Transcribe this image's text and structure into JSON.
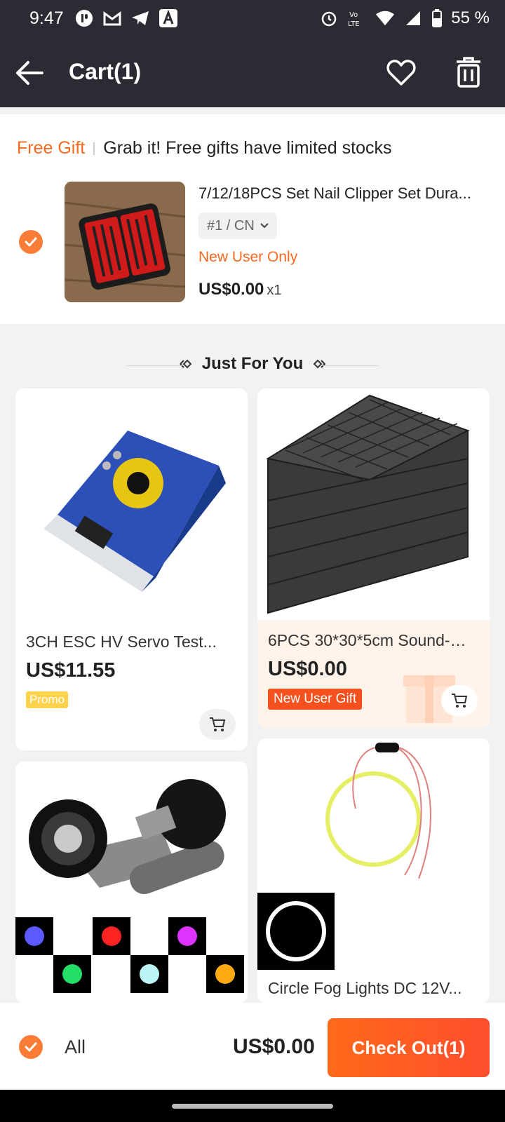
{
  "status_bar": {
    "time": "9:47",
    "battery": "55 %"
  },
  "header": {
    "title": "Cart(1)"
  },
  "gift_section": {
    "tag": "Free Gift",
    "note": "Grab it! Free gifts have limited stocks",
    "product": {
      "title": "7/12/18PCS Set Nail Clipper Set Dura...",
      "variant": "#1 / CN",
      "promo_label": "New User Only",
      "price": "US$0.00",
      "quantity": "x1",
      "selected": true
    }
  },
  "recommendations": {
    "heading": "Just For You",
    "items": [
      {
        "title": "3CH ESC HV Servo Test...",
        "price": "US$11.55",
        "badge": "Promo"
      },
      {
        "title": "6PCS 30*30*5cm Sound-a...",
        "price": "US$0.00",
        "badge": "New User Gift"
      },
      {
        "title": "",
        "price": "",
        "badge": ""
      },
      {
        "title": "Circle Fog Lights DC 12V...",
        "price": "",
        "badge": ""
      }
    ]
  },
  "bottom_bar": {
    "all_label": "All",
    "total": "US$0.00",
    "checkout_label": "Check Out(1)"
  },
  "colors": {
    "accent": "#f56a1f",
    "header_bg": "#2b2b33",
    "checkout_start": "#ff6a1a",
    "checkout_end": "#ff4d2d"
  }
}
